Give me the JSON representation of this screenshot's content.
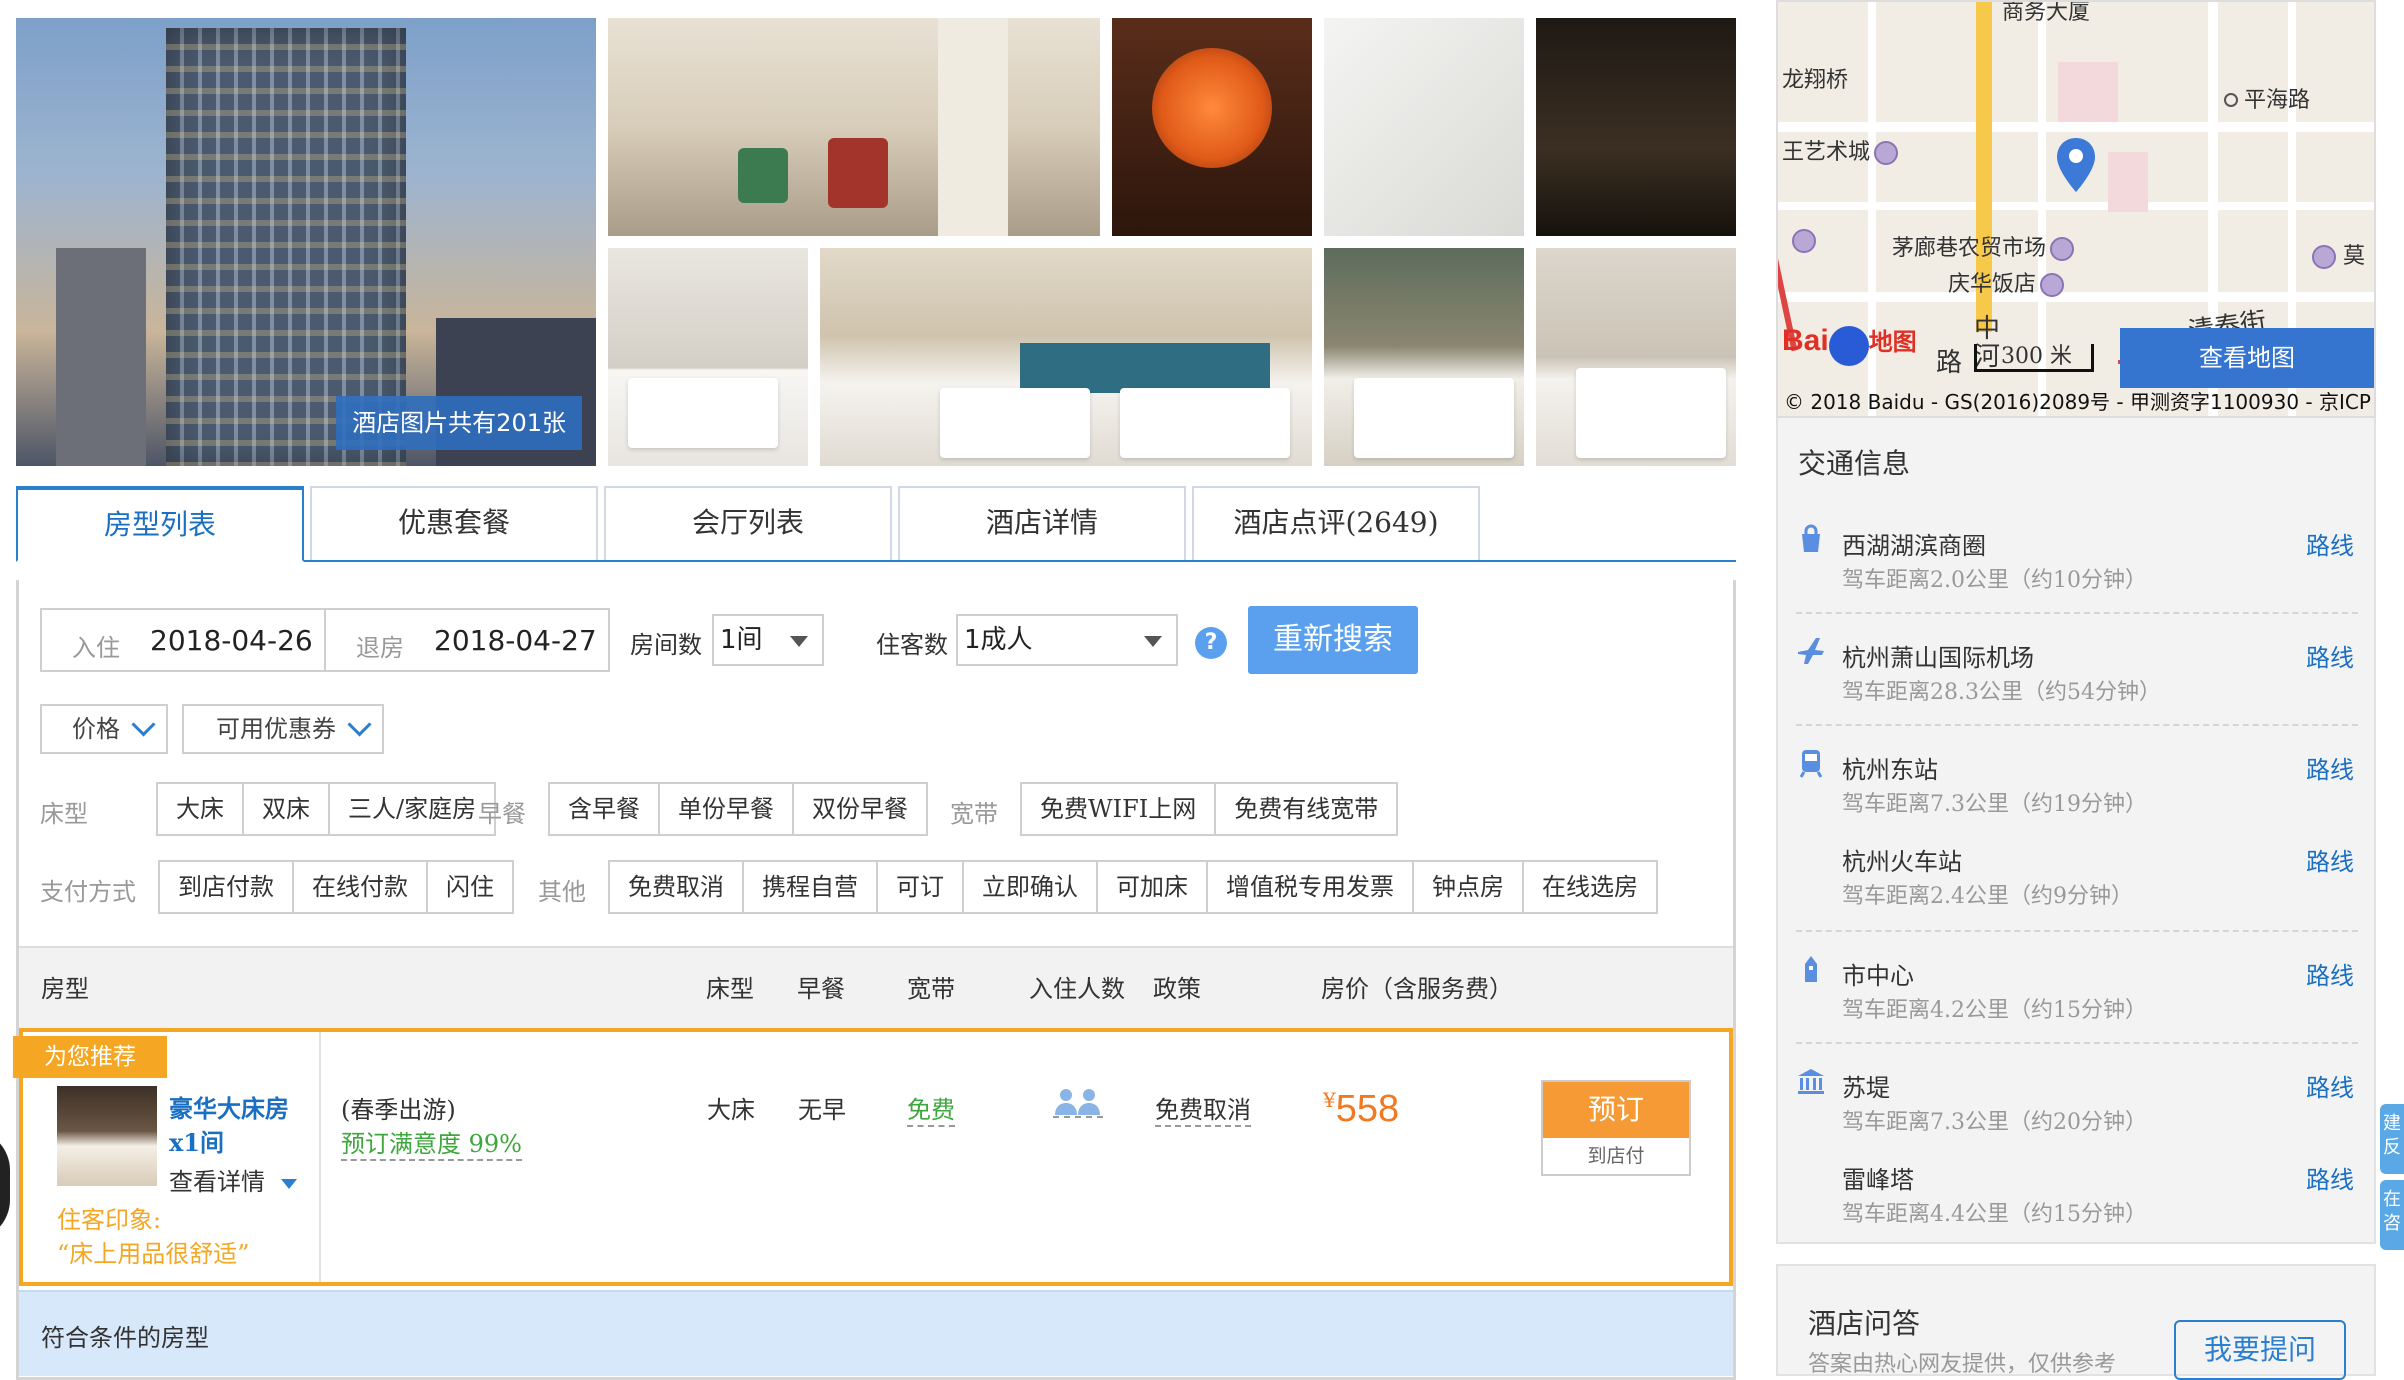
{
  "gallery": {
    "photo_count_caption": "酒店图片共有201张"
  },
  "tabs": [
    {
      "label": "房型列表",
      "active": true
    },
    {
      "label": "优惠套餐"
    },
    {
      "label": "会厅列表"
    },
    {
      "label": "酒店详情"
    },
    {
      "label": "酒店点评(2649)"
    }
  ],
  "search": {
    "checkin_label": "入住",
    "checkin_value": "2018-04-26",
    "checkout_label": "退房",
    "checkout_value": "2018-04-27",
    "rooms_label": "房间数",
    "rooms_value": "1间",
    "guests_label": "住客数",
    "guests_value": "1成人",
    "help_glyph": "?",
    "research_button": "重新搜索"
  },
  "filters": {
    "price_dropdown": "价格",
    "coupon_dropdown": "可用优惠券",
    "bed_label": "床型",
    "bed_options": [
      "大床",
      "双床",
      "三人/家庭房"
    ],
    "breakfast_label": "早餐",
    "breakfast_options": [
      "含早餐",
      "单份早餐",
      "双份早餐"
    ],
    "broadband_label": "宽带",
    "broadband_options": [
      "免费WIFI上网",
      "免费有线宽带"
    ],
    "payment_label": "支付方式",
    "payment_options": [
      "到店付款",
      "在线付款",
      "闪住"
    ],
    "other_label": "其他",
    "other_options": [
      "免费取消",
      "携程自营",
      "可订",
      "立即确认",
      "可加床",
      "增值税专用发票",
      "钟点房",
      "在线选房"
    ]
  },
  "table": {
    "headers": {
      "room_type": "房型",
      "bed": "床型",
      "breakfast": "早餐",
      "broadband": "宽带",
      "occupancy": "入住人数",
      "policy": "政策",
      "price": "房价（含服务费）"
    },
    "recommended": {
      "tag": "为您推荐",
      "room_name": "豪华大床房x1间",
      "details_link": "查看详情",
      "impression_label": "住客印象:",
      "impression_text": "“床上用品很舒适”",
      "package_name": "(春季出游)",
      "satisfaction": "预订满意度 99%",
      "bed": "大床",
      "breakfast": "无早",
      "broadband": "免费",
      "policy": "免费取消",
      "currency": "¥",
      "price": "558",
      "book_button": "预订",
      "pay_type": "到店付"
    },
    "matching_section": "符合条件的房型"
  },
  "map": {
    "labels": [
      "商务大厦",
      "龙翔桥",
      "平海路",
      "王艺术城",
      "茅廊巷农贸市场",
      "庆华饭店",
      "莫",
      "清泰街",
      "中",
      "河"
    ],
    "road_label": "路",
    "scale": "300 米",
    "brand_bai": "Bai",
    "brand_map": "地图",
    "view_map_button": "查看地图",
    "copyright": "© 2018 Baidu - GS(2016)2089号 - 甲测资字1100930 - 京ICP"
  },
  "transit": {
    "title": "交通信息",
    "items": [
      {
        "icon": "shopping-bag-icon",
        "name": "西湖湖滨商圈",
        "distance": "驾车距离2.0公里（约10分钟）",
        "link": "路线"
      },
      {
        "icon": "airplane-icon",
        "name": "杭州萧山国际机场",
        "distance": "驾车距离28.3公里（约54分钟）",
        "link": "路线"
      },
      {
        "icon": "train-icon",
        "name": "杭州东站",
        "distance": "驾车距离7.3公里（约19分钟）",
        "link": "路线"
      },
      {
        "icon": "",
        "name": "杭州火车站",
        "distance": "驾车距离2.4公里（约9分钟）",
        "link": "路线"
      },
      {
        "icon": "city-icon",
        "name": "市中心",
        "distance": "驾车距离4.2公里（约15分钟）",
        "link": "路线"
      },
      {
        "icon": "landmark-icon",
        "name": "苏堤",
        "distance": "驾车距离7.3公里（约20分钟）",
        "link": "路线"
      },
      {
        "icon": "",
        "name": "雷峰塔",
        "distance": "驾车距离4.4公里（约15分钟）",
        "link": "路线"
      }
    ]
  },
  "qa": {
    "title": "酒店问答",
    "subtitle": "答案由热心网友提供，仅供参考",
    "ask_button": "我要提问"
  },
  "side_float": {
    "items": [
      "建反",
      "在咨"
    ]
  },
  "colors": {
    "accent_blue": "#2b7fcf",
    "recommend_orange": "#f5a623",
    "price_orange": "#f07a22",
    "free_green": "#3da63d"
  }
}
